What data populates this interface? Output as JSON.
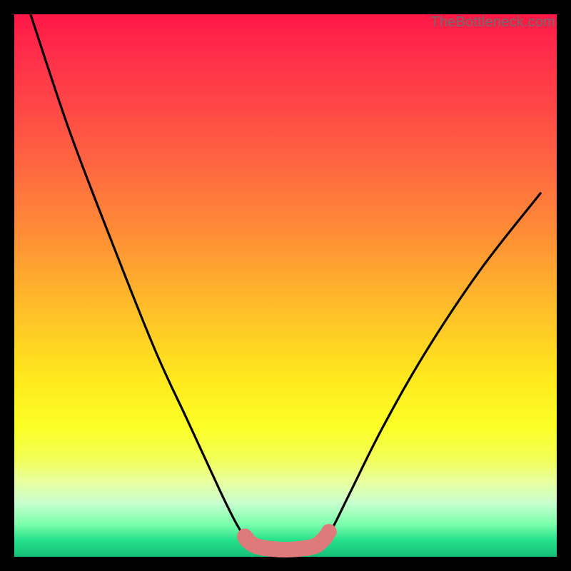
{
  "watermark": "TheBottleneck.com",
  "colors": {
    "frame": "#000000",
    "curve": "#000000",
    "marker_fill": "#de7b7a",
    "marker_stroke": "#de7b7a"
  },
  "chart_data": {
    "type": "line",
    "title": "",
    "xlabel": "",
    "ylabel": "",
    "xlim": [
      0,
      100
    ],
    "ylim": [
      0,
      100
    ],
    "grid": false,
    "legend": false,
    "note": "No axis ticks or numeric labels are rendered; values are inferred from curve geometry on a 0–100 normalized scale (x left→right, y bottom→top).",
    "series": [
      {
        "name": "bottleneck-curve",
        "x": [
          3,
          10,
          18,
          26,
          32,
          38,
          41,
          43,
          44.5,
          47,
          50,
          53,
          55.5,
          57,
          58.5,
          62,
          68,
          76,
          86,
          97
        ],
        "values": [
          100,
          79,
          58,
          38,
          25,
          12,
          6,
          3,
          2,
          1.5,
          1.3,
          1.5,
          2,
          3.2,
          5,
          12,
          24,
          38,
          53,
          67
        ]
      }
    ],
    "highlight_segment": {
      "description": "Rounded pink segment along the curve near the minimum (the 'sausage' marker).",
      "x_range": [
        42.5,
        57.5
      ],
      "dots": [
        {
          "x": 42.8,
          "y": 3.4
        },
        {
          "x": 55.8,
          "y": 2.1
        },
        {
          "x": 58.0,
          "y": 4.6
        }
      ]
    }
  }
}
